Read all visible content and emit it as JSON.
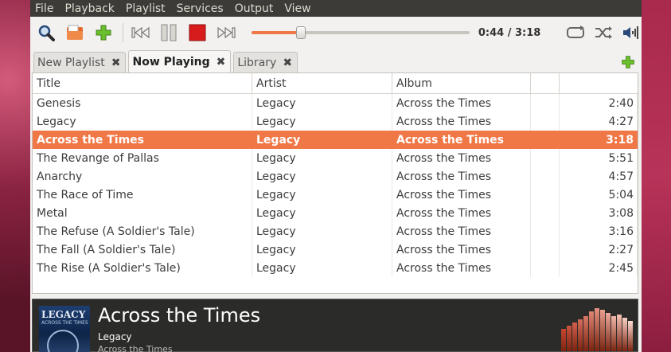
{
  "menu": [
    "File",
    "Playback",
    "Playlist",
    "Services",
    "Output",
    "View"
  ],
  "toolbar": {
    "time": "0:44 / 3:18",
    "progress_fraction": 0.226
  },
  "tabs": [
    {
      "label": "New Playlist",
      "active": false
    },
    {
      "label": "Now Playing",
      "active": true
    },
    {
      "label": "Library",
      "active": false
    }
  ],
  "columns": {
    "title": "Title",
    "artist": "Artist",
    "album": "Album",
    "blank": "",
    "length": ""
  },
  "tracks": [
    {
      "title": "Genesis",
      "artist": "Legacy",
      "album": "Across the Times",
      "length": "2:40",
      "playing": false
    },
    {
      "title": "Legacy",
      "artist": "Legacy",
      "album": "Across the Times",
      "length": "4:27",
      "playing": false
    },
    {
      "title": "Across the Times",
      "artist": "Legacy",
      "album": "Across the Times",
      "length": "3:18",
      "playing": true
    },
    {
      "title": "The Revange of Pallas",
      "artist": "Legacy",
      "album": "Across the Times",
      "length": "5:51",
      "playing": false
    },
    {
      "title": "Anarchy",
      "artist": "Legacy",
      "album": "Across the Times",
      "length": "4:57",
      "playing": false
    },
    {
      "title": "The Race of Time",
      "artist": "Legacy",
      "album": "Across the Times",
      "length": "5:04",
      "playing": false
    },
    {
      "title": "Metal",
      "artist": "Legacy",
      "album": "Across the Times",
      "length": "3:08",
      "playing": false
    },
    {
      "title": "The Refuse (A Soldier's Tale)",
      "artist": "Legacy",
      "album": "Across the Times",
      "length": "3:16",
      "playing": false
    },
    {
      "title": "The Fall (A Soldier's Tale)",
      "artist": "Legacy",
      "album": "Across the Times",
      "length": "2:27",
      "playing": false
    },
    {
      "title": "The Rise (A Soldier's Tale)",
      "artist": "Legacy",
      "album": "Across the Times",
      "length": "2:45",
      "playing": false
    }
  ],
  "now_playing": {
    "title": "Across the Times",
    "artist": "Legacy",
    "album": "Across the Times",
    "cover_title": "LEGACY",
    "cover_subtitle": "ACROSS THE TIMES"
  },
  "colors": {
    "accent": "#f07746",
    "menubar": "#3c3b37"
  }
}
